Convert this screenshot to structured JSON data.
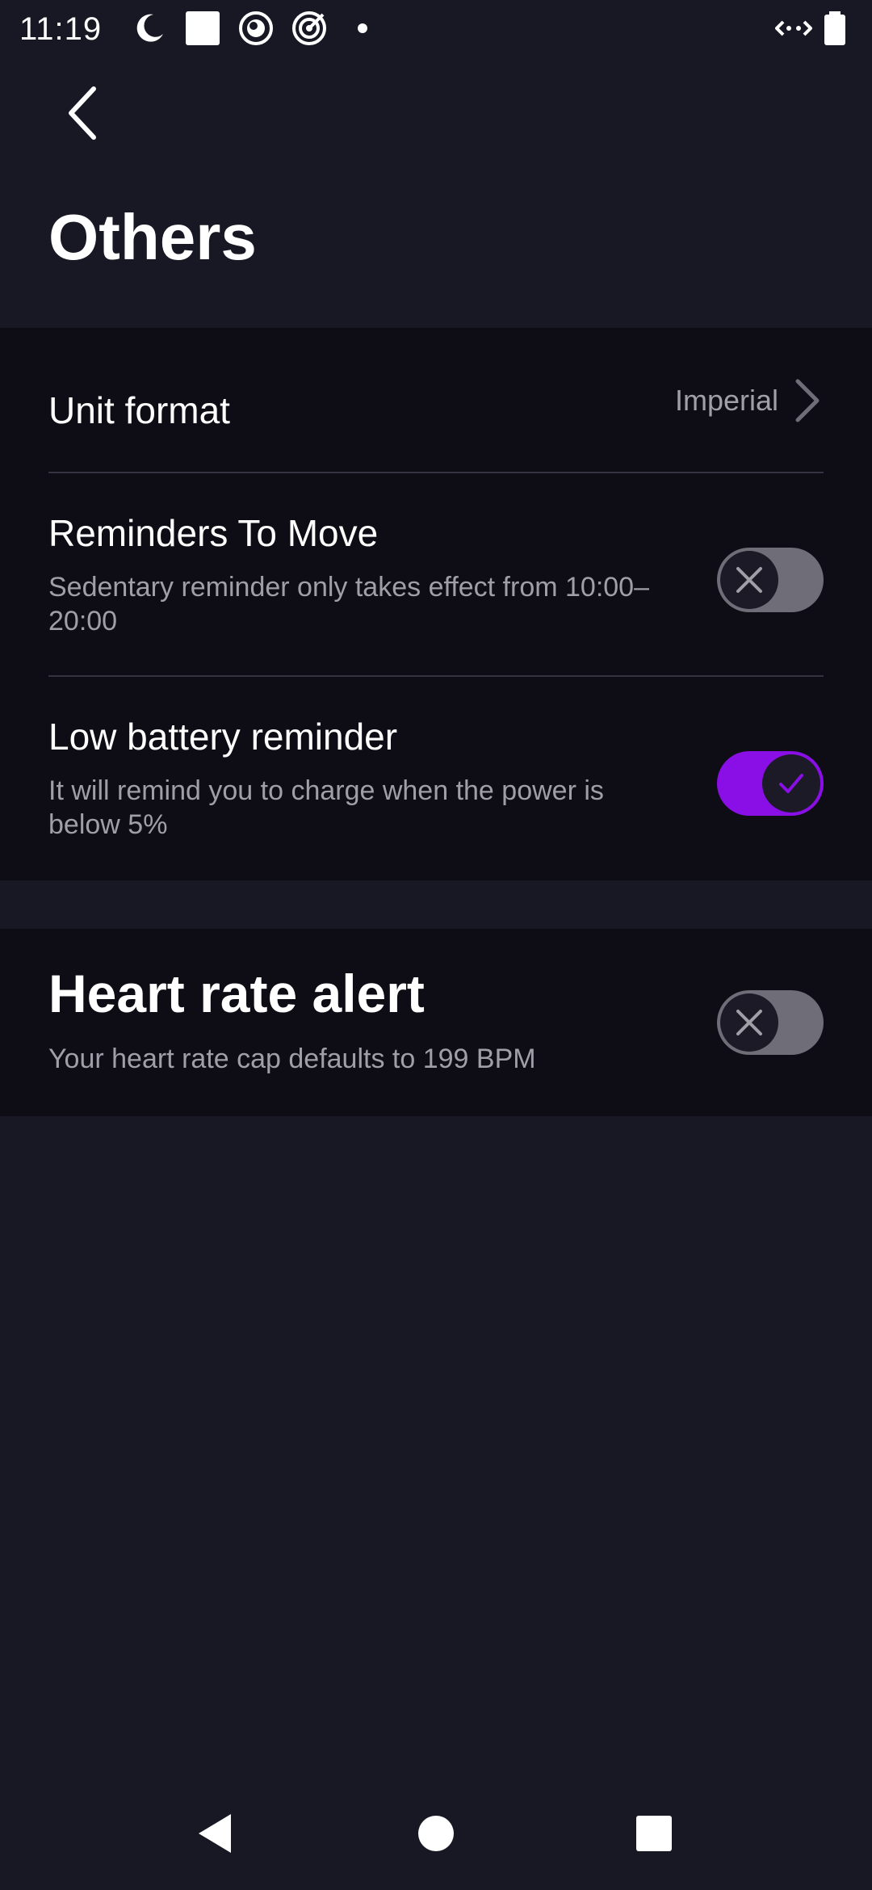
{
  "status_bar": {
    "time": "11:19",
    "icons": [
      "do-not-disturb-icon",
      "white-square-icon",
      "sync-circle-icon",
      "target-icon",
      "dot-icon",
      "data-transfer-icon",
      "battery-icon"
    ]
  },
  "header": {
    "back_icon": "back-arrow-icon",
    "title": "Others"
  },
  "settings": {
    "unit_format": {
      "label": "Unit format",
      "value": "Imperial"
    },
    "reminders_to_move": {
      "label": "Reminders To Move",
      "description": "Sedentary reminder only takes effect from 10:00–20:00",
      "enabled": false
    },
    "low_battery": {
      "label": "Low battery reminder",
      "description": "It will remind you to charge when the power is below 5%",
      "enabled": true
    },
    "heart_rate_alert": {
      "label": "Heart rate alert",
      "description": "Your heart rate cap defaults to 199 BPM",
      "enabled": false
    }
  },
  "nav_bar": {
    "icons": [
      "nav-back-icon",
      "nav-home-icon",
      "nav-recents-icon"
    ]
  },
  "colors": {
    "background": "#181724",
    "card": "#0e0d15",
    "accent": "#8a0fe6",
    "toggle_off": "#6f6e78",
    "secondary_text": "#a09fa8"
  }
}
